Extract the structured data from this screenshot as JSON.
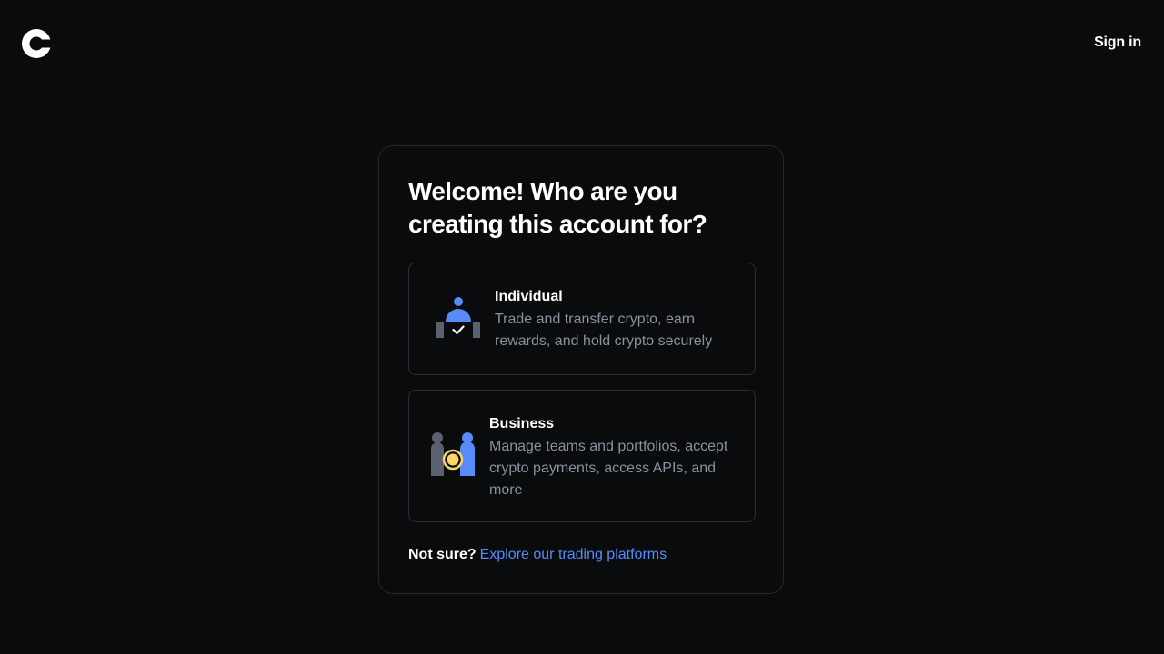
{
  "header": {
    "logo_icon": "coinbase-logo-icon",
    "signin_label": "Sign in"
  },
  "card": {
    "title": "Welcome! Who are you creating this account for?",
    "options": [
      {
        "icon": "individual-person-icon",
        "title": "Individual",
        "description": "Trade and transfer crypto, earn rewards, and hold crypto securely"
      },
      {
        "icon": "business-people-icon",
        "title": "Business",
        "description": "Manage teams and portfolios, accept crypto payments, access APIs, and more"
      }
    ],
    "footer": {
      "prompt": "Not sure?",
      "link_label": "Explore our trading platforms"
    }
  },
  "colors": {
    "background": "#0a0b0d",
    "accent_blue": "#578bfa",
    "muted_text": "#8a919e",
    "border": "#2c2e33",
    "coin_yellow": "#f8d56b"
  }
}
